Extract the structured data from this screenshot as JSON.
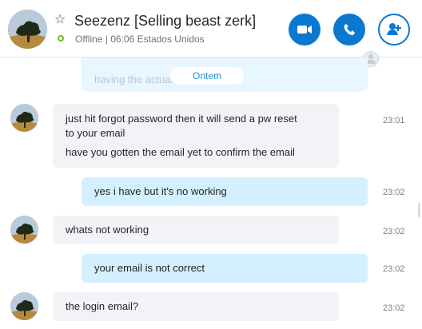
{
  "header": {
    "title": "Seezenz [Selling beast zerk]",
    "status": "Offline | 06:06 Estados Unidos"
  },
  "chat": {
    "previous_preview": "having the actual one",
    "date_separator": "Ontem",
    "messages": [
      {
        "direction": "incoming",
        "lines": [
          "just hit forgot password then it will send a pw reset",
          "to your email",
          "have you gotten the email yet to confirm the email"
        ],
        "time": "23:01"
      },
      {
        "direction": "outgoing",
        "lines": [
          "yes i have but it's no working"
        ],
        "time": "23:02"
      },
      {
        "direction": "incoming",
        "lines": [
          "whats not working"
        ],
        "time": "23:02"
      },
      {
        "direction": "outgoing",
        "lines": [
          "your email is not correct"
        ],
        "time": "23:02"
      },
      {
        "direction": "incoming",
        "lines": [
          "the login email?"
        ],
        "time": "23:02"
      }
    ]
  },
  "theme": {
    "accent": "#0b78d0",
    "incoming_bubble": "#f1f3f6",
    "outgoing_bubble": "#d4efff",
    "presence": "#75b72d"
  },
  "icons": {
    "favorite": "star-outline-icon",
    "video": "video-call-icon",
    "call": "phone-icon",
    "add": "add-person-icon",
    "participant": "small-user-icon"
  }
}
